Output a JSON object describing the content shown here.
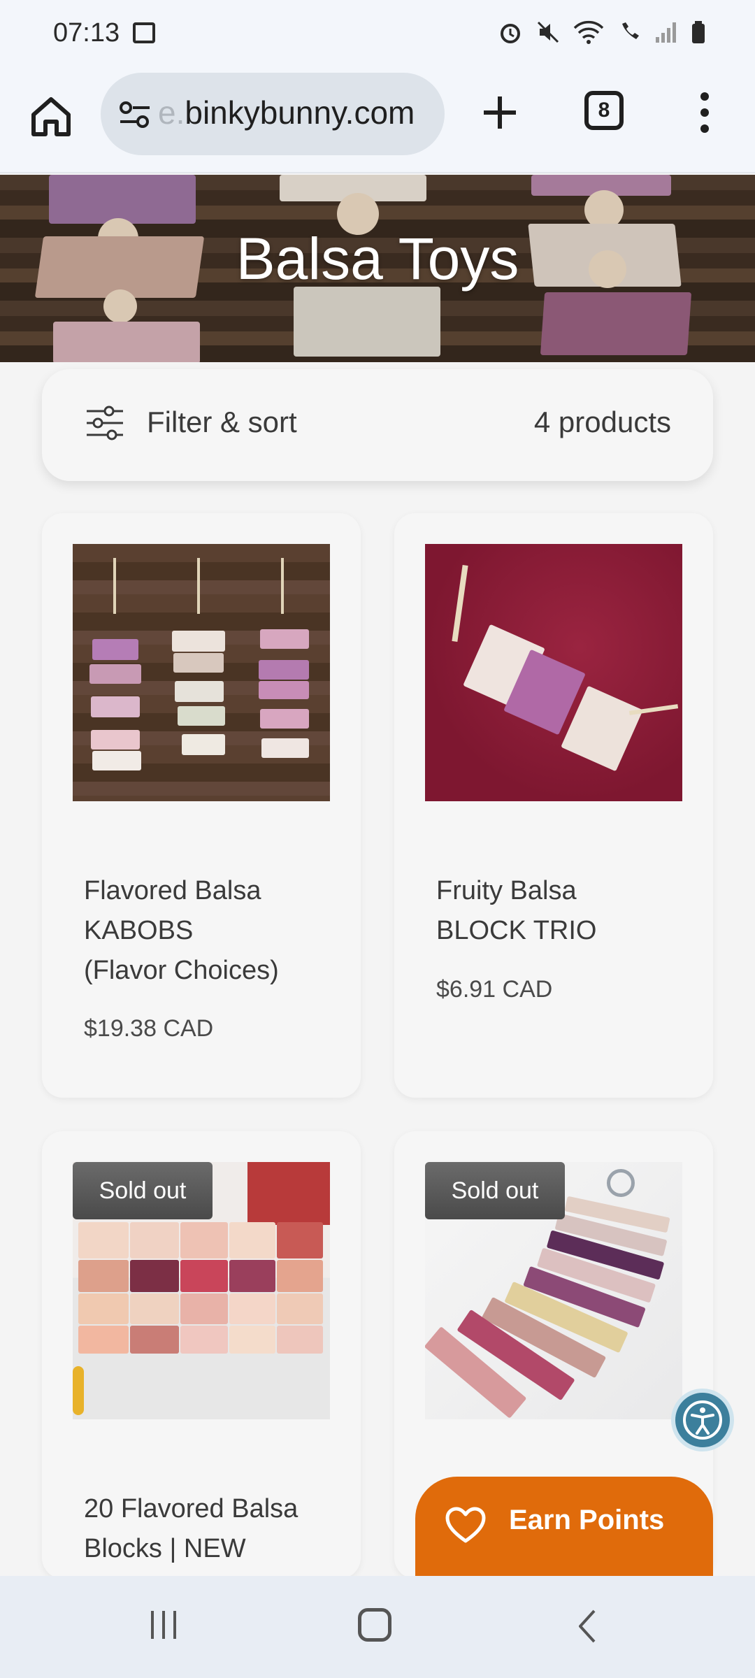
{
  "status_bar": {
    "time": "07:13"
  },
  "browser": {
    "url_prefix": "e.",
    "url": "binkybunny.com",
    "tab_count": "8"
  },
  "hero": {
    "title": "Balsa Toys"
  },
  "filter": {
    "label": "Filter & sort",
    "count": "4 products"
  },
  "products": [
    {
      "title_lines": [
        "Flavored Balsa",
        "KABOBS",
        "(Flavor Choices)"
      ],
      "price": "$19.38 CAD",
      "badge": ""
    },
    {
      "title_lines": [
        "Fruity Balsa",
        "BLOCK TRIO"
      ],
      "price": "$6.91 CAD",
      "badge": ""
    },
    {
      "title_lines": [
        "20 Flavored Balsa",
        "Blocks | NEW"
      ],
      "price": "",
      "badge": "Sold out"
    },
    {
      "title_lines": [],
      "price": "",
      "badge": "Sold out"
    }
  ],
  "rewards": {
    "label": "Earn Points"
  },
  "colors": {
    "accent_orange": "#e06b0b",
    "a11y_blue": "#3c7f9c"
  }
}
